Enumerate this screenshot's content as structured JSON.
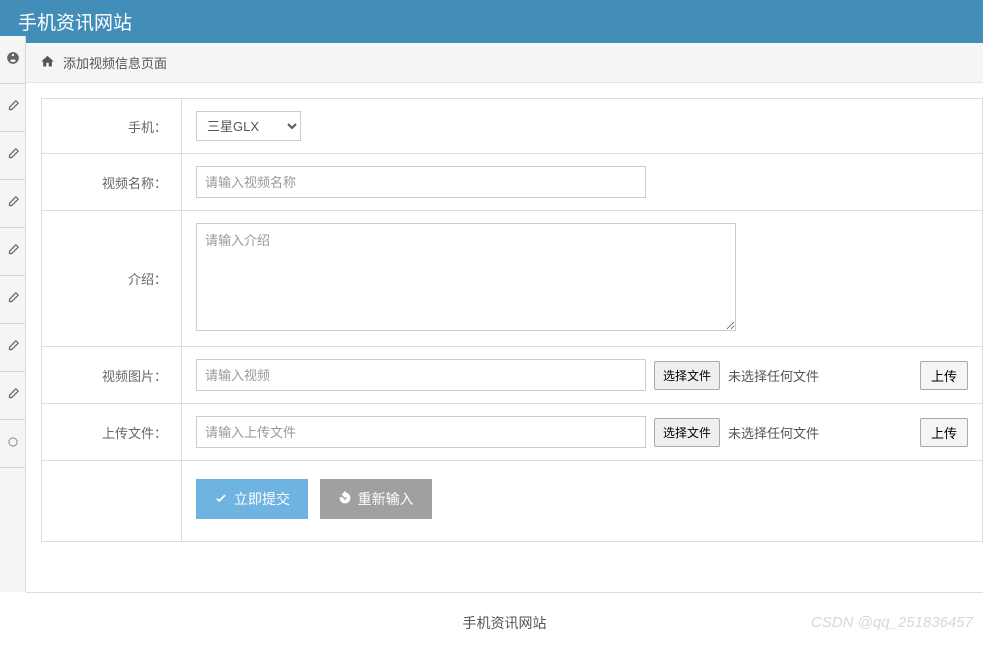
{
  "header": {
    "title": "手机资讯网站"
  },
  "breadcrumb": {
    "text": "添加视频信息页面"
  },
  "form": {
    "phone": {
      "label": "手机：",
      "selected": "三星GLX"
    },
    "videoName": {
      "label": "视频名称：",
      "placeholder": "请输入视频名称",
      "value": ""
    },
    "intro": {
      "label": "介绍：",
      "placeholder": "请输入介绍",
      "value": ""
    },
    "videoImage": {
      "label": "视频图片：",
      "placeholder": "请输入视频",
      "value": "",
      "chooseFile": "选择文件",
      "noFile": "未选择任何文件",
      "upload": "上传"
    },
    "uploadFile": {
      "label": "上传文件：",
      "placeholder": "请输入上传文件",
      "value": "",
      "chooseFile": "选择文件",
      "noFile": "未选择任何文件",
      "upload": "上传"
    },
    "buttons": {
      "submit": "立即提交",
      "reset": "重新输入"
    }
  },
  "footer": {
    "text": "手机资讯网站",
    "watermark": "CSDN @qq_251836457"
  }
}
